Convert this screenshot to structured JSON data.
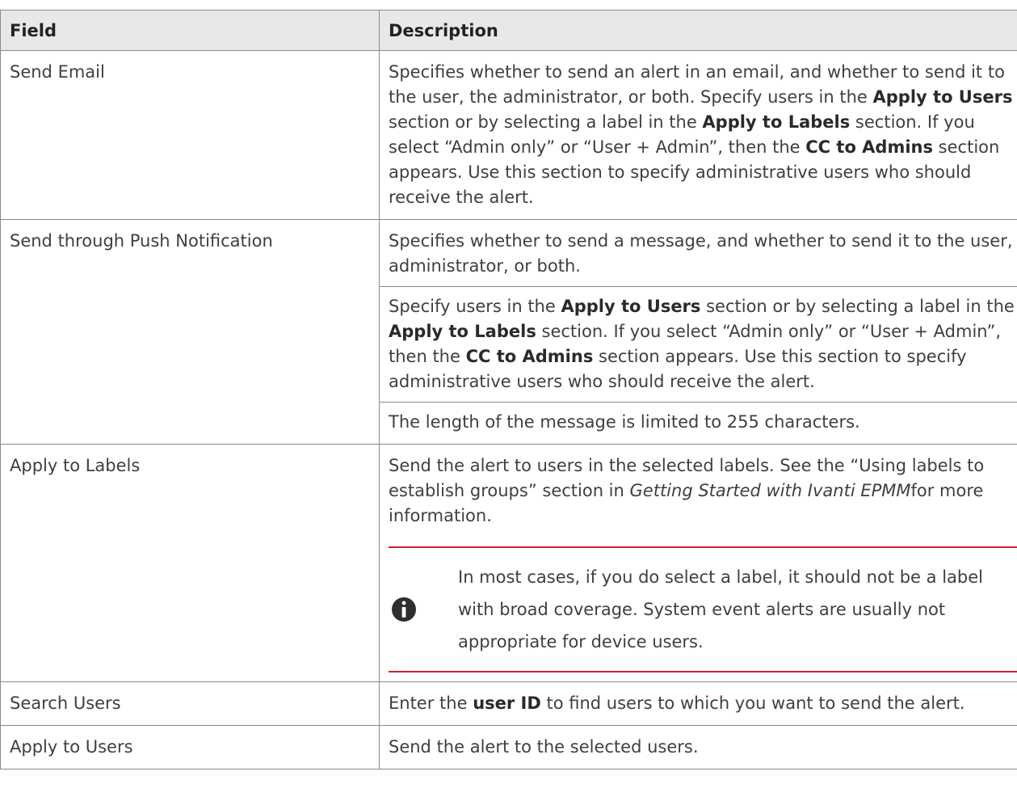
{
  "table": {
    "headers": {
      "field": "Field",
      "description": "Description"
    },
    "rows": [
      {
        "field": "Send Email",
        "description": [
          {
            "t": "Specifies whether to send an alert in an email, and whether to send it to the user, the administrator, or both. Specify users in the "
          },
          {
            "b": "Apply to Users"
          },
          {
            "t": " section or by selecting a label in the "
          },
          {
            "b": "Apply to Labels"
          },
          {
            "t": " section. If you select “Admin only” or “User + Admin”, then the "
          },
          {
            "b": "CC to Admins"
          },
          {
            "t": " section appears. Use this section to specify administrative users who should receive the alert."
          }
        ]
      },
      {
        "field": "Send through Push Notification",
        "description_intro": "Specifies whether to send a message, and whether to send it to the user, administrator, or both.",
        "description": [
          {
            "t": "Specify users in the "
          },
          {
            "b": "Apply to Users"
          },
          {
            "t": " section or by selecting a label in the "
          },
          {
            "b": "Apply to Labels"
          },
          {
            "t": " section. If you select “Admin only” or “User + Admin”, then the "
          },
          {
            "b": "CC to Admins"
          },
          {
            "t": " section appears. Use this section to specify administrative users who should receive the alert."
          }
        ],
        "description_footer": "The length of the message is limited to 255 characters."
      },
      {
        "field": "Apply to Labels",
        "description": [
          {
            "t": "Send the alert to users in the selected labels. See the “Using labels to establish groups” section in "
          },
          {
            "i": "Getting Started with Ivanti EPMM"
          },
          {
            "t": "for more information."
          }
        ],
        "note": "In most cases, if you do select a label, it should not be a label with broad coverage. System event alerts are usually not appropriate for device users."
      },
      {
        "field": "Search Users",
        "description": [
          {
            "t": "Enter the "
          },
          {
            "b": "user ID"
          },
          {
            "t": " to find users to which you want to send the alert."
          }
        ]
      },
      {
        "field": "Apply to Users",
        "description": [
          {
            "t": "Send the alert to the selected users."
          }
        ]
      }
    ]
  }
}
